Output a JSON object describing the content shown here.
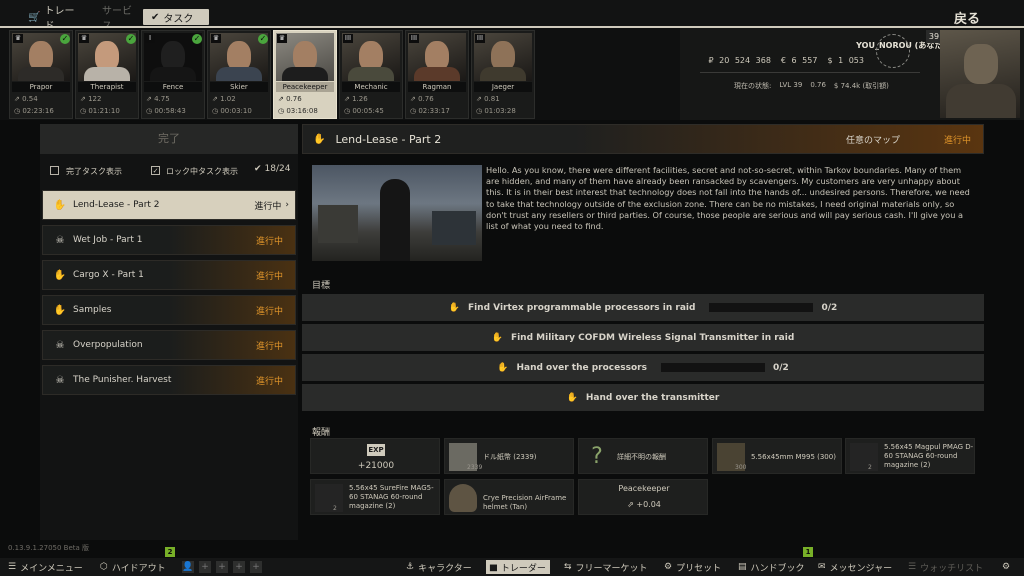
{
  "top_tabs": {
    "trade": "トレード",
    "services": "サービス",
    "tasks": "タスク"
  },
  "back_label": "戻る",
  "traders": [
    {
      "name": "Prapor",
      "badge": "♛",
      "checked": true,
      "stat1": "0.54",
      "stat2": "02:23:16"
    },
    {
      "name": "Therapist",
      "badge": "♛",
      "checked": true,
      "stat1": "122",
      "stat2": "01:21:10"
    },
    {
      "name": "Fence",
      "badge": "I",
      "checked": true,
      "stat1": "4.75",
      "stat2": "00:58:43"
    },
    {
      "name": "Skier",
      "badge": "♛",
      "checked": true,
      "stat1": "1.02",
      "stat2": "00:03:10"
    },
    {
      "name": "Peacekeeper",
      "badge": "♛",
      "checked": false,
      "stat1": "0.76",
      "stat2": "03:16:08"
    },
    {
      "name": "Mechanic",
      "badge": "III",
      "checked": false,
      "stat1": "1.26",
      "stat2": "00:05:45"
    },
    {
      "name": "Ragman",
      "badge": "III",
      "checked": false,
      "stat1": "0.76",
      "stat2": "02:33:17"
    },
    {
      "name": "Jaeger",
      "badge": "III",
      "checked": false,
      "stat1": "0.81",
      "stat2": "01:03:28"
    }
  ],
  "profile": {
    "name": "YOU_NOROU (あなた)",
    "rubles": "₽ 20 524 368",
    "euros": "€ 6 557",
    "dollars": "$ 1 053",
    "status_label": "現在の状態:",
    "level": "LVL 39",
    "rep": "0.76",
    "sales": "$ 74.4k (取引額)",
    "level_badge": "39"
  },
  "left_panel": {
    "completed_header": "完了",
    "show_completed": "完了タスク表示",
    "show_locked": "ロック中タスク表示",
    "task_count": "18/24"
  },
  "tasks": [
    {
      "name": "Lend-Lease - Part 2",
      "status": "進行中",
      "icon": "✋",
      "selected": true
    },
    {
      "name": "Wet Job - Part 1",
      "status": "進行中",
      "icon": "☠",
      "selected": false
    },
    {
      "name": "Cargo X - Part 1",
      "status": "進行中",
      "icon": "✋",
      "selected": false
    },
    {
      "name": "Samples",
      "status": "進行中",
      "icon": "✋",
      "selected": false
    },
    {
      "name": "Overpopulation",
      "status": "進行中",
      "icon": "☠",
      "selected": false
    },
    {
      "name": "The Punisher. Harvest",
      "status": "進行中",
      "icon": "☠",
      "selected": false
    }
  ],
  "quest": {
    "title": "Lend-Lease - Part 2",
    "map": "任意のマップ",
    "status": "進行中",
    "description": "Hello. As you know, there were different facilities, secret and not-so-secret, within Tarkov boundaries. Many of them are hidden, and many of them have already been ransacked by scavengers. My customers are very unhappy about this. It is in their best interest that technology does not fall into the hands of... undesired persons. Therefore, we need to take that technology outside of the exclusion zone. There can be no mistakes, I need original materials only, so don't trust any resellers or third parties. Of course, those people are serious and will pay serious cash. I'll give you a list of what you need to find.",
    "objectives_label": "目標",
    "objectives": [
      {
        "text": "Find Virtex programmable processors in raid",
        "progress": "0/2"
      },
      {
        "text": "Find Military COFDM Wireless Signal Transmitter in raid",
        "progress": ""
      },
      {
        "text": "Hand over the processors",
        "progress": "0/2"
      },
      {
        "text": "Hand over the transmitter",
        "progress": ""
      }
    ],
    "rewards_label": "報酬"
  },
  "rewards": {
    "exp_badge": "EXP",
    "exp_value": "+21000",
    "dollars": {
      "label": "ドル紙幣 (2339)",
      "count": "2339"
    },
    "unknown": {
      "label": "詳細不明の報酬",
      "icon": "?"
    },
    "m995": {
      "label": "5.56x45mm M995 (300)",
      "count": "300"
    },
    "pmag": {
      "label": "5.56x45 Magpul PMAG D-60 STANAG 60-round magazine (2)",
      "count": "2"
    },
    "surefire": {
      "label": "5.56x45 SureFire MAG5-60 STANAG 60-round magazine (2)",
      "count": "2"
    },
    "airframe": {
      "label": "Crye Precision AirFrame helmet (Tan)"
    },
    "rep_trader": "Peacekeeper",
    "rep_value": "+0.04"
  },
  "version": "0.13.9.1.27050 Beta 版",
  "bottom_bar": {
    "main_menu": "メインメニュー",
    "hideout": "ハイドアウト",
    "character": "キャラクター",
    "traders": "トレーダー",
    "flea_market": "フリーマーケット",
    "presets": "プリセット",
    "handbook": "ハンドブック",
    "messenger": "メッセンジャー",
    "watchlist": "ウォッチリスト",
    "notify_hideout": "2",
    "notify_handbook": "1"
  }
}
